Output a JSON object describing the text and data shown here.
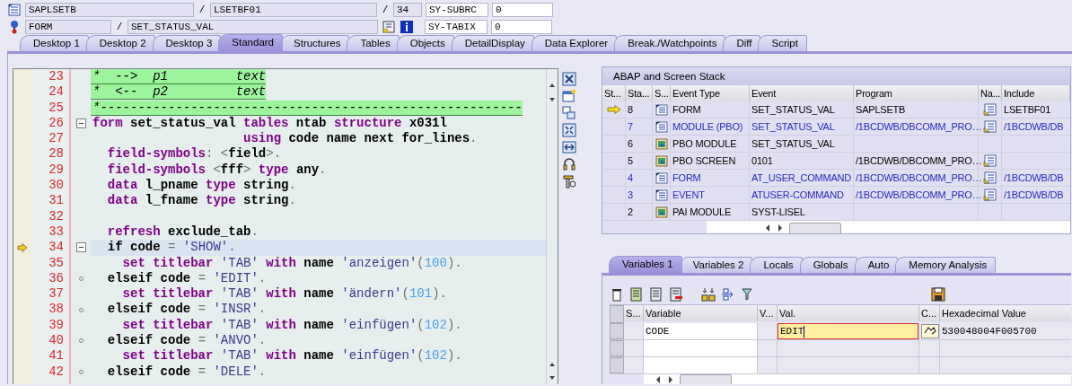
{
  "header": {
    "row1": {
      "program": "SAPLSETB",
      "sep1": "/",
      "include": "LSETBF01",
      "sep2": "/",
      "line": "34",
      "var_name": "SY-SUBRC",
      "var_value": "0"
    },
    "row2": {
      "event_type": "FORM",
      "sep": "/",
      "event": "SET_STATUS_VAL",
      "var_name": "SY-TABIX",
      "var_value": "0"
    }
  },
  "tabs": [
    {
      "label": "Desktop 1",
      "selected": false
    },
    {
      "label": "Desktop 2",
      "selected": false
    },
    {
      "label": "Desktop 3",
      "selected": false
    },
    {
      "label": "Standard",
      "selected": true
    },
    {
      "label": "Structures",
      "selected": false
    },
    {
      "label": "Tables",
      "selected": false
    },
    {
      "label": "Objects",
      "selected": false
    },
    {
      "label": "DetailDisplay",
      "selected": false
    },
    {
      "label": "Data Explorer",
      "selected": false
    },
    {
      "label": "Break./Watchpoints",
      "selected": false
    },
    {
      "label": "Diff",
      "selected": false
    },
    {
      "label": "Script",
      "selected": false
    }
  ],
  "editor": {
    "lines": [
      {
        "number": "23",
        "current": false,
        "kind": "comment",
        "tokens": [
          {
            "kind": "c",
            "text": "*  -->  p1         text"
          }
        ]
      },
      {
        "number": "24",
        "current": false,
        "kind": "comment",
        "tokens": [
          {
            "kind": "c",
            "text": "*  <--  p2         text"
          }
        ]
      },
      {
        "number": "25",
        "current": false,
        "kind": "comment",
        "tokens": [
          {
            "kind": "c",
            "text": "*--------------------------------------------------------"
          }
        ]
      },
      {
        "number": "26",
        "current": false,
        "expanded": true,
        "kind": "code",
        "tokens": [
          {
            "kind": "k",
            "text": "form"
          },
          {
            "kind": "t",
            "text": " set_status_val "
          },
          {
            "kind": "k",
            "text": "tables"
          },
          {
            "kind": "t",
            "text": " ntab "
          },
          {
            "kind": "k",
            "text": "structure"
          },
          {
            "kind": "t",
            "text": " x031l"
          }
        ]
      },
      {
        "number": "27",
        "current": false,
        "kind": "code",
        "tokens": [
          {
            "kind": "k",
            "text": "                    using"
          },
          {
            "kind": "t",
            "text": " code name next for_lines"
          },
          {
            "kind": "p",
            "text": "."
          }
        ]
      },
      {
        "number": "28",
        "current": false,
        "kind": "code",
        "tokens": [
          {
            "kind": "k",
            "text": "  field-symbols"
          },
          {
            "kind": "p",
            "text": ": <"
          },
          {
            "kind": "t",
            "text": "field"
          },
          {
            "kind": "p",
            "text": ">."
          }
        ]
      },
      {
        "number": "29",
        "current": false,
        "kind": "code",
        "tokens": [
          {
            "kind": "k",
            "text": "  field-symbols"
          },
          {
            "kind": "p",
            "text": " <"
          },
          {
            "kind": "t",
            "text": "fff"
          },
          {
            "kind": "p",
            "text": ">"
          },
          {
            "kind": "k",
            "text": " type"
          },
          {
            "kind": "t",
            "text": " any"
          },
          {
            "kind": "p",
            "text": "."
          }
        ]
      },
      {
        "number": "30",
        "current": false,
        "kind": "code",
        "tokens": [
          {
            "kind": "k",
            "text": "  data"
          },
          {
            "kind": "t",
            "text": " l_pname "
          },
          {
            "kind": "k",
            "text": "type"
          },
          {
            "kind": "t",
            "text": " string"
          },
          {
            "kind": "p",
            "text": "."
          }
        ]
      },
      {
        "number": "31",
        "current": false,
        "kind": "code",
        "tokens": [
          {
            "kind": "k",
            "text": "  data"
          },
          {
            "kind": "t",
            "text": " l_fname "
          },
          {
            "kind": "k",
            "text": "type"
          },
          {
            "kind": "t",
            "text": " string"
          },
          {
            "kind": "p",
            "text": "."
          }
        ]
      },
      {
        "number": "32",
        "current": false,
        "kind": "code"
      },
      {
        "number": "33",
        "current": false,
        "kind": "code",
        "tokens": [
          {
            "kind": "k",
            "text": "  refresh"
          },
          {
            "kind": "t",
            "text": " exclude_tab"
          },
          {
            "kind": "p",
            "text": "."
          }
        ]
      },
      {
        "number": "34",
        "current": true,
        "expanded": true,
        "kind": "code",
        "tokens": [
          {
            "kind": "t",
            "text": "  if code "
          },
          {
            "kind": "p",
            "text": "="
          },
          {
            "kind": "s",
            "text": " 'SHOW'"
          },
          {
            "kind": "p",
            "text": "."
          }
        ]
      },
      {
        "number": "35",
        "current": false,
        "kind": "code",
        "tokens": [
          {
            "kind": "k",
            "text": "    set titlebar"
          },
          {
            "kind": "s",
            "text": " 'TAB'"
          },
          {
            "kind": "k",
            "text": " with"
          },
          {
            "kind": "t",
            "text": " name "
          },
          {
            "kind": "s",
            "text": "'anzeigen'"
          },
          {
            "kind": "p",
            "text": "("
          },
          {
            "kind": "n",
            "text": "100"
          },
          {
            "kind": "p",
            "text": ")."
          }
        ]
      },
      {
        "number": "36",
        "current": false,
        "branch": true,
        "kind": "code",
        "tokens": [
          {
            "kind": "t",
            "text": "  elseif code "
          },
          {
            "kind": "p",
            "text": "="
          },
          {
            "kind": "s",
            "text": " 'EDIT'"
          },
          {
            "kind": "p",
            "text": "."
          }
        ]
      },
      {
        "number": "37",
        "current": false,
        "kind": "code",
        "tokens": [
          {
            "kind": "k",
            "text": "    set titlebar"
          },
          {
            "kind": "s",
            "text": " 'TAB'"
          },
          {
            "kind": "k",
            "text": " with"
          },
          {
            "kind": "t",
            "text": " name "
          },
          {
            "kind": "s",
            "text": "'ändern'"
          },
          {
            "kind": "p",
            "text": "("
          },
          {
            "kind": "n",
            "text": "101"
          },
          {
            "kind": "p",
            "text": ")."
          }
        ]
      },
      {
        "number": "38",
        "current": false,
        "branch": true,
        "kind": "code",
        "tokens": [
          {
            "kind": "t",
            "text": "  elseif code "
          },
          {
            "kind": "p",
            "text": "="
          },
          {
            "kind": "s",
            "text": " 'INSR'"
          },
          {
            "kind": "p",
            "text": "."
          }
        ]
      },
      {
        "number": "39",
        "current": false,
        "kind": "code",
        "tokens": [
          {
            "kind": "k",
            "text": "    set titlebar"
          },
          {
            "kind": "s",
            "text": " 'TAB'"
          },
          {
            "kind": "k",
            "text": " with"
          },
          {
            "kind": "t",
            "text": " name "
          },
          {
            "kind": "s",
            "text": "'einfügen'"
          },
          {
            "kind": "p",
            "text": "("
          },
          {
            "kind": "n",
            "text": "102"
          },
          {
            "kind": "p",
            "text": ")."
          }
        ]
      },
      {
        "number": "40",
        "current": false,
        "branch": true,
        "kind": "code",
        "tokens": [
          {
            "kind": "t",
            "text": "  elseif code "
          },
          {
            "kind": "p",
            "text": "="
          },
          {
            "kind": "s",
            "text": " 'ANVO'"
          },
          {
            "kind": "p",
            "text": "."
          }
        ]
      },
      {
        "number": "41",
        "current": false,
        "kind": "code",
        "tokens": [
          {
            "kind": "k",
            "text": "    set titlebar"
          },
          {
            "kind": "s",
            "text": " 'TAB'"
          },
          {
            "kind": "k",
            "text": " with"
          },
          {
            "kind": "t",
            "text": " name "
          },
          {
            "kind": "s",
            "text": "'einfügen'"
          },
          {
            "kind": "p",
            "text": "("
          },
          {
            "kind": "n",
            "text": "102"
          },
          {
            "kind": "p",
            "text": ")."
          }
        ]
      },
      {
        "number": "42",
        "current": false,
        "branch": true,
        "kind": "code",
        "tokens": [
          {
            "kind": "t",
            "text": "  elseif code "
          },
          {
            "kind": "p",
            "text": "="
          },
          {
            "kind": "s",
            "text": " 'DELE'"
          },
          {
            "kind": "p",
            "text": "."
          }
        ]
      }
    ]
  },
  "stack": {
    "title": "ABAP and Screen Stack",
    "columns": [
      "St...",
      "Sta...",
      "S...",
      "Event Type",
      "Event",
      "Program",
      "Na...",
      "Include"
    ],
    "rows": [
      {
        "current": true,
        "level": "8",
        "kind": "form",
        "event_type": "FORM",
        "event": "SET_STATUS_VAL",
        "program": "SAPLSETB",
        "nav": true,
        "include": "LSETBF01",
        "linked": false
      },
      {
        "current": false,
        "level": "7",
        "kind": "form",
        "event_type": "MODULE (PBO)",
        "event": "SET_STATUS_VAL",
        "program": "/1BCDWB/DBCOMM_PRO…",
        "nav": true,
        "include": "/1BCDWB/DB",
        "linked": true
      },
      {
        "current": false,
        "level": "6",
        "kind": "screen",
        "event_type": "PBO MODULE",
        "event": "SET_STATUS_VAL",
        "nav": false,
        "linked": false
      },
      {
        "current": false,
        "level": "5",
        "kind": "screen",
        "event_type": "PBO SCREEN",
        "event": "0101",
        "program": "/1BCDWB/DBCOMM_PRO…",
        "nav": true,
        "linked": false
      },
      {
        "current": false,
        "level": "4",
        "kind": "form",
        "event_type": "FORM",
        "event": "AT_USER_COMMAND",
        "program": "/1BCDWB/DBCOMM_PRO…",
        "nav": true,
        "include": "/1BCDWB/DB",
        "linked": true
      },
      {
        "current": false,
        "level": "3",
        "kind": "form",
        "event_type": "EVENT",
        "event": "ATUSER-COMMAND",
        "program": "/1BCDWB/DBCOMM_PRO…",
        "nav": true,
        "include": "/1BCDWB/DB",
        "linked": true
      },
      {
        "current": false,
        "level": "2",
        "kind": "screen",
        "event_type": "PAI MODULE",
        "event": "SYST-LISEL",
        "nav": false,
        "linked": false
      }
    ]
  },
  "var_tabs": [
    {
      "label": "Variables 1",
      "selected": true
    },
    {
      "label": "Variables 2",
      "selected": false
    },
    {
      "label": "Locals",
      "selected": false
    },
    {
      "label": "Globals",
      "selected": false
    },
    {
      "label": "Auto",
      "selected": false
    },
    {
      "label": "Memory Analysis",
      "selected": false
    }
  ],
  "variables": {
    "columns": [
      "S...",
      "Variable",
      "V...",
      "Val.",
      "C...",
      "Hexadecimal Value"
    ],
    "rows": [
      {
        "variable": "CODE",
        "value": "EDIT",
        "editing": true,
        "hex": "530048004F005700"
      },
      {
        "editing": false
      },
      {
        "editing": false
      }
    ]
  }
}
